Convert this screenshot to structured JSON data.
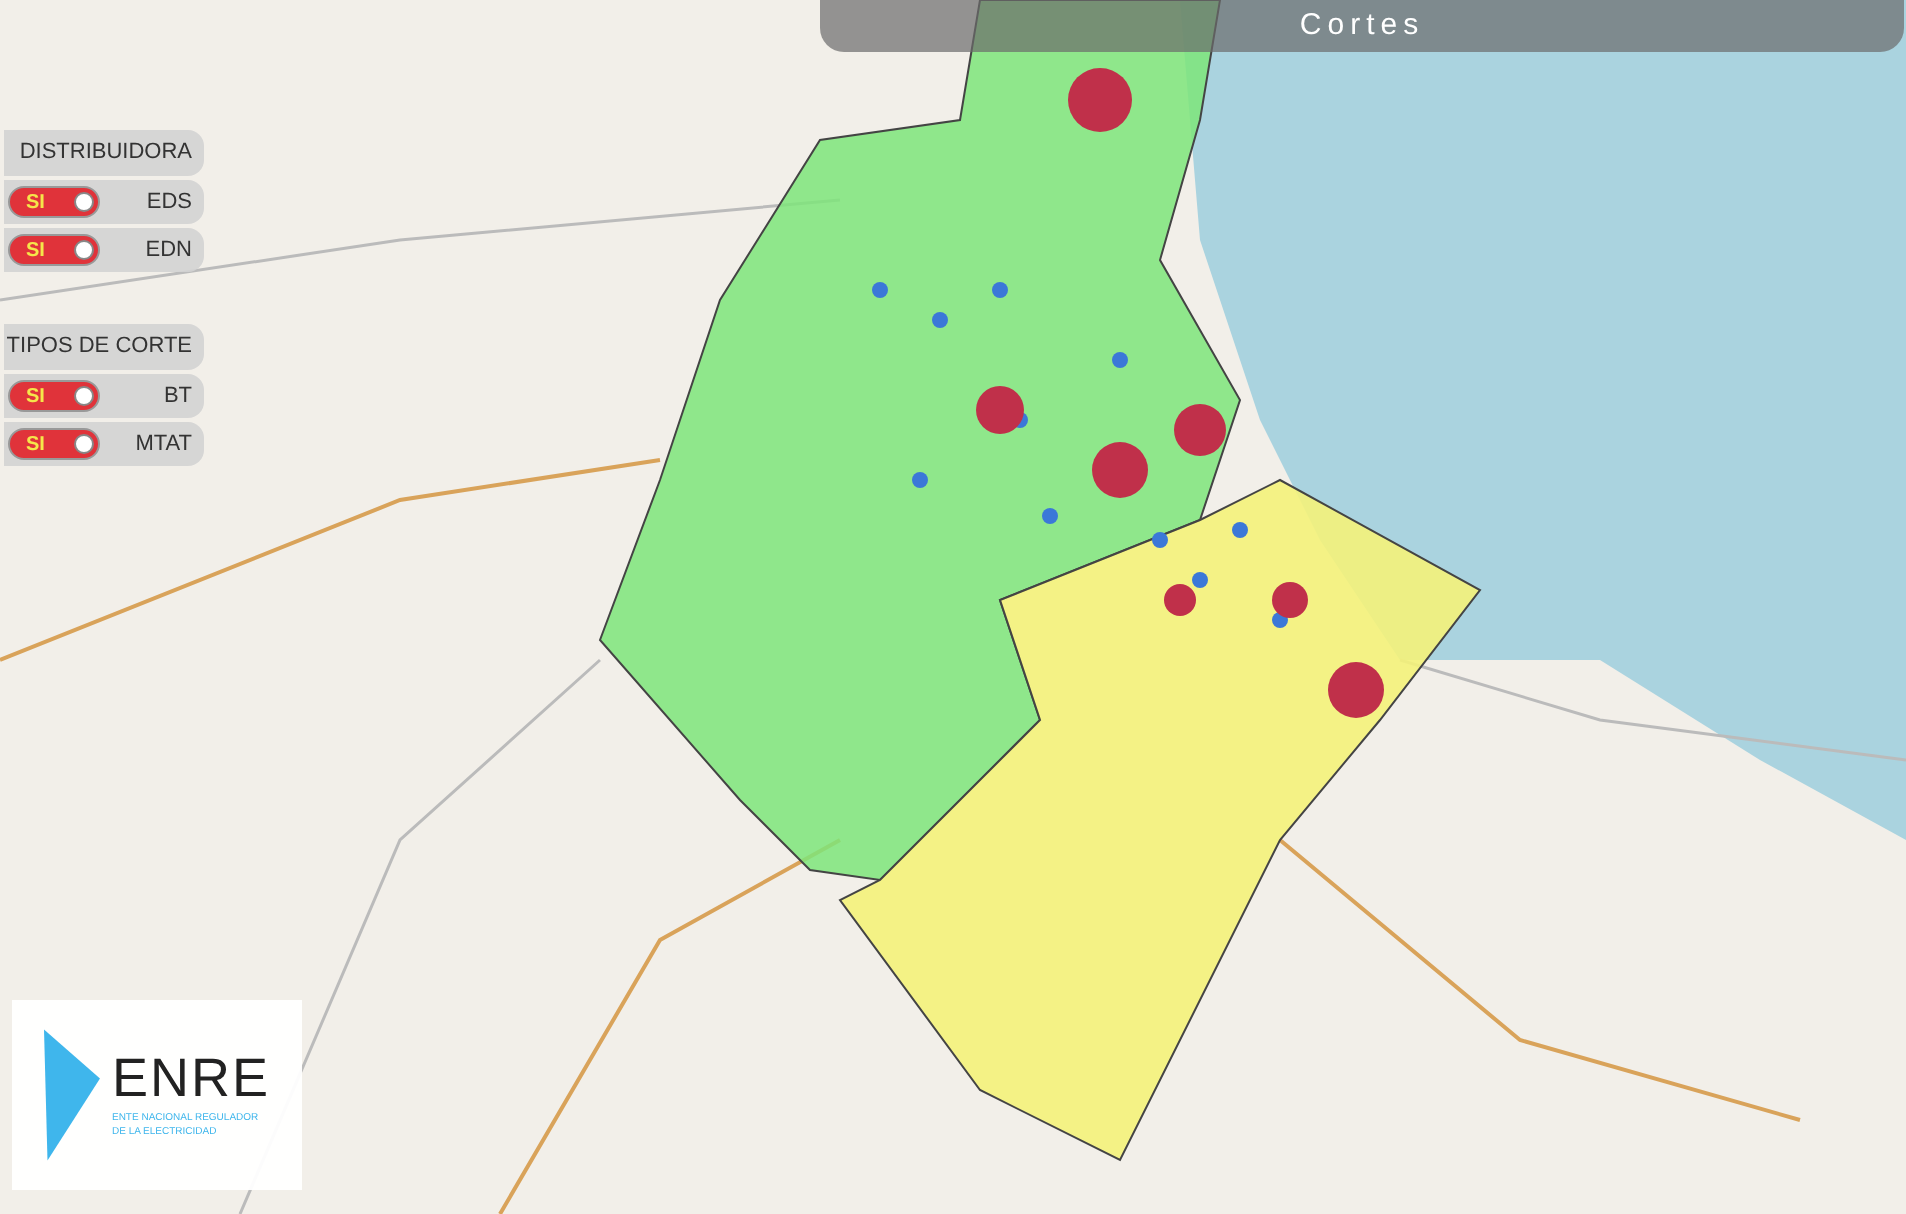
{
  "title": "Cortes",
  "filter_groups": [
    {
      "heading": "DISTRIBUIDORA",
      "toggles": [
        {
          "label": "EDS",
          "on_text": "SI",
          "on": true
        },
        {
          "label": "EDN",
          "on_text": "SI",
          "on": true
        }
      ]
    },
    {
      "heading": "TIPOS DE CORTE",
      "toggles": [
        {
          "label": "BT",
          "on_text": "SI",
          "on": true
        },
        {
          "label": "MTAT",
          "on_text": "SI",
          "on": true
        }
      ]
    }
  ],
  "logo": {
    "name": "ENRE",
    "subtitle_lines": [
      "ENTE NACIONAL REGULADOR",
      "DE LA ELECTRICIDAD"
    ]
  }
}
